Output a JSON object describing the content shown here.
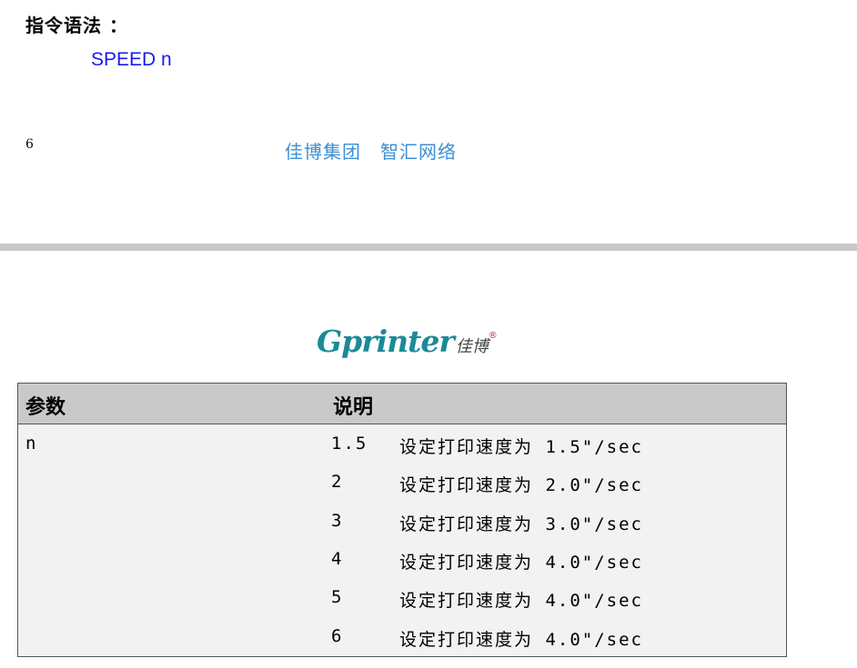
{
  "syntax": {
    "label": "指令语法 ：",
    "command": "SPEED n"
  },
  "footer": {
    "page_number": "6",
    "text": "佳博集团　智汇网络"
  },
  "logo": {
    "brand": "Gprinter",
    "brand_cn": "佳博",
    "registered": "®"
  },
  "table": {
    "headers": [
      "参数",
      "说明"
    ],
    "param": "n",
    "rows": [
      {
        "value": "1.5",
        "desc": "设定打印速度为 1.5\"/sec"
      },
      {
        "value": "2",
        "desc": "设定打印速度为 2.0\"/sec"
      },
      {
        "value": "3",
        "desc": "设定打印速度为 3.0\"/sec"
      },
      {
        "value": "4",
        "desc": "设定打印速度为 4.0\"/sec"
      },
      {
        "value": "5",
        "desc": "设定打印速度为 4.0\"/sec"
      },
      {
        "value": "6",
        "desc": "设定打印速度为 4.0\"/sec"
      }
    ]
  },
  "colors": {
    "command": "#1a1af0",
    "footer": "#3c8fd6",
    "logo": "#1b8a98",
    "header_bg": "#c9c9c9",
    "table_bg": "#f2f2f2"
  }
}
